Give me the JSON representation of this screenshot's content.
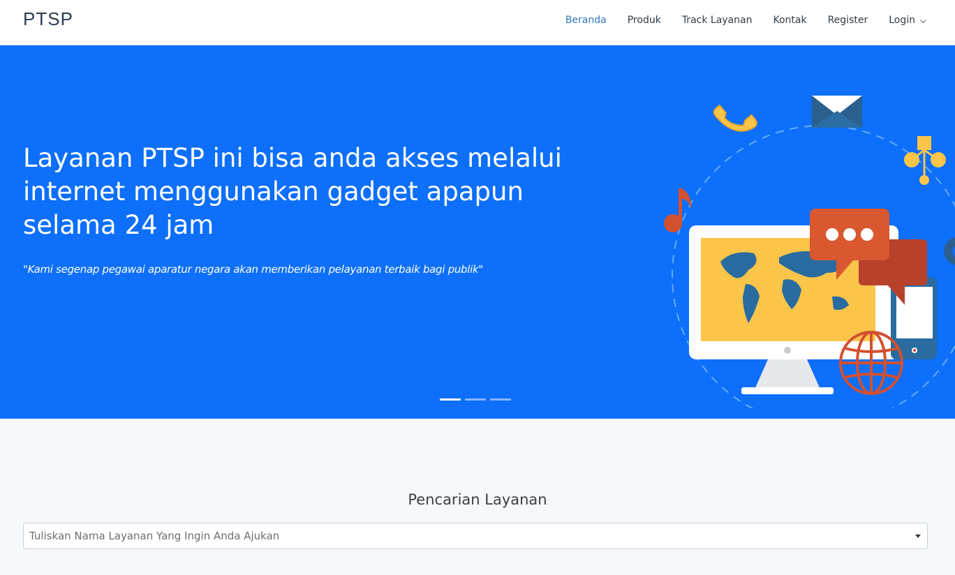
{
  "brand": "PTSP",
  "nav": {
    "items": [
      {
        "label": "Beranda",
        "active": true
      },
      {
        "label": "Produk"
      },
      {
        "label": "Track Layanan"
      },
      {
        "label": "Kontak"
      },
      {
        "label": "Register"
      },
      {
        "label": "Login"
      }
    ]
  },
  "hero": {
    "title": "Layanan PTSP ini bisa anda akses melalui internet menggunakan gadget apapun selama 24 jam",
    "quote": "\"Kami segenap pegawai aparatur negara akan memberikan pelayanan terbaik bagi publik\"",
    "slides": 3,
    "active_slide": 1,
    "background": "#0d6ffa"
  },
  "search": {
    "title": "Pencarian Layanan",
    "placeholder": "Tuliskan Nama Layanan Yang Ingin Anda Ajukan"
  },
  "icons": [
    "chevron-down-icon",
    "phone-icon",
    "mail-icon",
    "network-icon",
    "music-note-icon",
    "monitor-icon",
    "chat-icon",
    "globe-icon",
    "smartphone-icon",
    "gear-icon"
  ]
}
